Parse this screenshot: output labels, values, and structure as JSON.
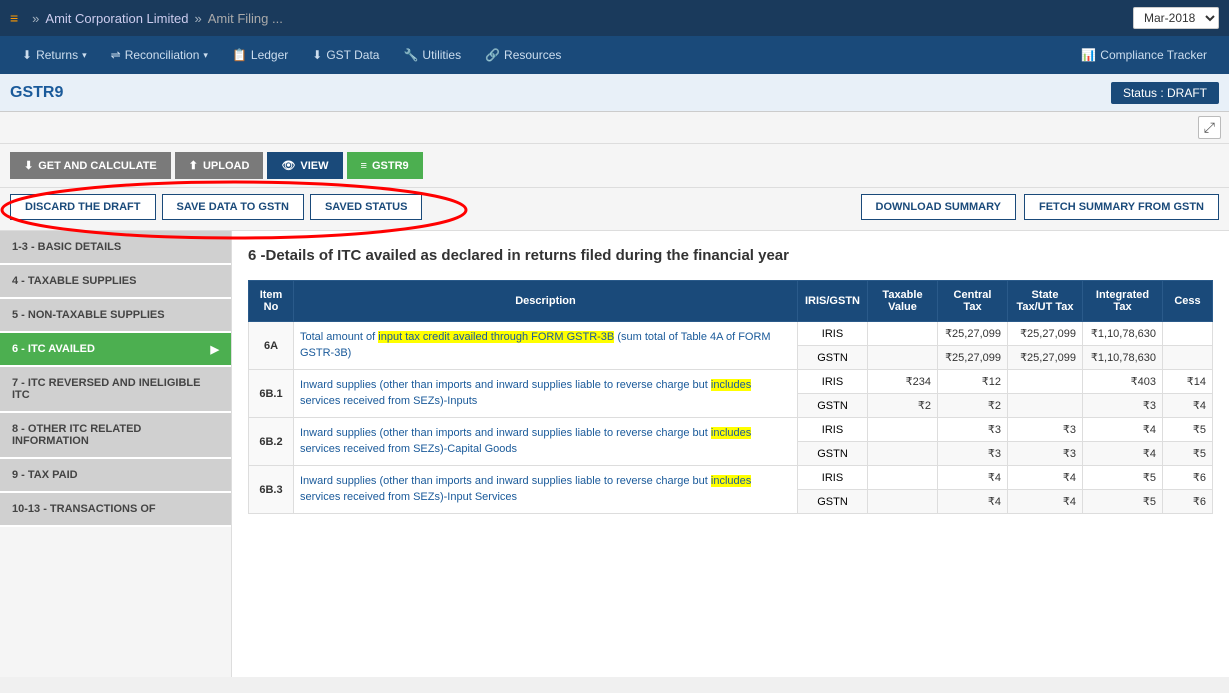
{
  "topbar": {
    "logo": "≡",
    "sep1": "»",
    "company": "Amit Corporation Limited",
    "sep2": "»",
    "filing": "Amit Filing ...",
    "period": "Mar-2018"
  },
  "nav": {
    "items": [
      {
        "label": "Returns",
        "icon": "⬇",
        "hasArrow": true
      },
      {
        "label": "Reconciliation",
        "icon": "⇌",
        "hasArrow": true
      },
      {
        "label": "Ledger",
        "icon": "📋",
        "hasArrow": false
      },
      {
        "label": "GST Data",
        "icon": "⬇",
        "hasArrow": false
      },
      {
        "label": "Utilities",
        "icon": "🔧",
        "hasArrow": false
      },
      {
        "label": "Resources",
        "icon": "🔗",
        "hasArrow": false
      }
    ],
    "right": "Compliance Tracker"
  },
  "gstr9bar": {
    "title": "GSTR9",
    "status": "Status : DRAFT"
  },
  "actionRow1": {
    "btn_get": "GET AND CALCULATE",
    "btn_upload": "UPLOAD",
    "btn_view": "VIEW",
    "btn_gstr9": "GSTR9"
  },
  "actionRow2": {
    "btn_discard": "DISCARD THE DRAFT",
    "btn_save": "SAVE DATA TO GSTN",
    "btn_saved_status": "SAVED STATUS",
    "btn_download": "DOWNLOAD SUMMARY",
    "btn_fetch": "FETCH SUMMARY FROM GSTN"
  },
  "sidebar": {
    "items": [
      {
        "label": "1-3 - BASIC DETAILS",
        "active": false
      },
      {
        "label": "4 - TAXABLE SUPPLIES",
        "active": false
      },
      {
        "label": "5 - NON-TAXABLE SUPPLIES",
        "active": false
      },
      {
        "label": "6 - ITC AVAILED",
        "active": true
      },
      {
        "label": "7 - ITC REVERSED AND INELIGIBLE ITC",
        "active": false
      },
      {
        "label": "8 - OTHER ITC RELATED INFORMATION",
        "active": false
      },
      {
        "label": "9 - TAX PAID",
        "active": false
      },
      {
        "label": "10-13 - TRANSACTIONS OF",
        "active": false
      }
    ]
  },
  "content": {
    "section_title": "6 -Details of ITC availed as declared in returns filed during the financial year",
    "table": {
      "headers": [
        "Item No",
        "Description",
        "IRIS/GSTN",
        "Taxable Value",
        "Central Tax",
        "State Tax/UT Tax",
        "Integrated Tax",
        "Cess"
      ],
      "rows": [
        {
          "item": "6A",
          "desc": "Total amount of input tax credit availed through FORM GSTR-3B (sum total of Table 4A of FORM GSTR-3B)",
          "desc_highlight_words": [
            "input tax credit availed through FORM GSTR-3B"
          ],
          "iris": "IRIS",
          "taxable": "",
          "central": "₹25,27,099",
          "state": "₹25,27,099",
          "integrated": "₹1,10,78,630",
          "cess": ""
        },
        {
          "item": "",
          "desc": "",
          "iris": "GSTN",
          "taxable": "",
          "central": "₹25,27,099",
          "state": "₹25,27,099",
          "integrated": "₹1,10,78,630",
          "cess": ""
        },
        {
          "item": "6B.1",
          "desc": "Inward supplies (other than imports and inward supplies liable to reverse charge but includes services received from SEZs)-Inputs",
          "desc_highlight_words": [
            "includes"
          ],
          "iris": "IRIS",
          "taxable": "₹234",
          "central": "₹12",
          "state": "",
          "integrated": "₹403",
          "cess": "₹14"
        },
        {
          "item": "",
          "desc": "",
          "iris": "GSTN",
          "taxable": "₹2",
          "central": "₹2",
          "state": "",
          "integrated": "₹3",
          "cess": "₹4"
        },
        {
          "item": "6B.2",
          "desc": "Inward supplies (other than imports and inward supplies liable to reverse charge but includes services received from SEZs)-Capital Goods",
          "desc_highlight_words": [
            "includes"
          ],
          "iris": "IRIS",
          "taxable": "",
          "central": "₹3",
          "state": "₹3",
          "integrated": "₹4",
          "cess": "₹5"
        },
        {
          "item": "",
          "desc": "",
          "iris": "GSTN",
          "taxable": "",
          "central": "₹3",
          "state": "₹3",
          "integrated": "₹4",
          "cess": "₹5"
        },
        {
          "item": "6B.3",
          "desc": "Inward supplies (other than imports and inward supplies liable to reverse charge but includes services received from SEZs)-Input Services",
          "desc_highlight_words": [
            "includes"
          ],
          "iris": "IRIS",
          "taxable": "",
          "central": "₹4",
          "state": "₹4",
          "integrated": "₹5",
          "cess": "₹6"
        },
        {
          "item": "",
          "desc": "",
          "iris": "GSTN",
          "taxable": "",
          "central": "₹4",
          "state": "₹4",
          "integrated": "₹5",
          "cess": "₹6"
        }
      ]
    }
  }
}
